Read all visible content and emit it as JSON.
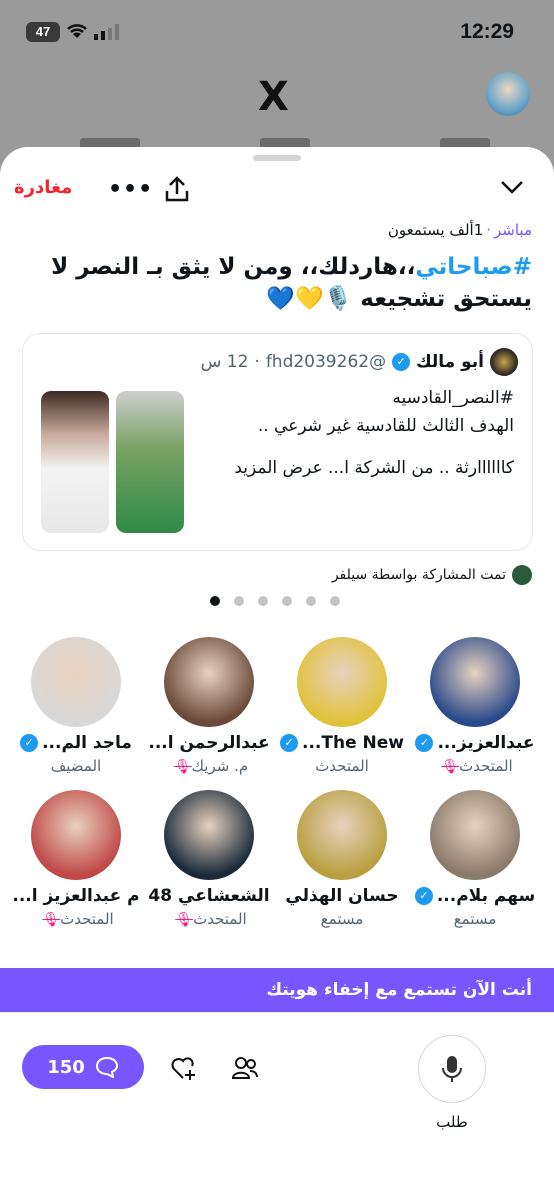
{
  "status": {
    "time": "12:29",
    "battery": "47"
  },
  "header": {
    "logo": "X"
  },
  "space": {
    "leave_label": "مغادرة",
    "live_label": "مباشر",
    "listeners": "1ألف يستمعون",
    "hashtag": "#صباحاتي",
    "title_rest": "،،هاردلك،، ومن لا يثق بـ النصر لا يستحق تشجيعه 🎙️💛💙"
  },
  "tweet": {
    "name": "أبو مالك",
    "handle": "@fhd2039262",
    "time": "12 س",
    "line1": "#النصر_القادسيه",
    "line2": "الهدف الثالث للقادسية غير شرعي ..",
    "line3": "كاااااارثة .. من الشركة ا... عرض المزيد"
  },
  "shared_by": "تمت المشاركة بواسطة سيلفر",
  "participants": [
    {
      "name": "عبدالعزيز...",
      "role": "المتحدث",
      "verified": true,
      "muted": true,
      "color": "#2b4a8b"
    },
    {
      "name": "The New...",
      "role": "المتحدث",
      "verified": true,
      "muted": false,
      "color": "#e0c23a"
    },
    {
      "name": "عبدالرحمن ا...",
      "role": "م. شريك",
      "verified": false,
      "muted": true,
      "color": "#6b4a3a"
    },
    {
      "name": "ماجد الم...",
      "role": "المضيف",
      "verified": true,
      "muted": false,
      "color": "#d8d8d8"
    },
    {
      "name": "سهم بلام...",
      "role": "مستمع",
      "verified": true,
      "muted": false,
      "color": "#8a7a6a"
    },
    {
      "name": "حسان الهذلي",
      "role": "مستمع",
      "verified": false,
      "muted": false,
      "color": "#b8a040"
    },
    {
      "name": "الشعشاعي 48",
      "role": "المتحدث",
      "verified": false,
      "muted": true,
      "color": "#1a2a3a"
    },
    {
      "name": "م عبدالعزيز ا...",
      "role": "المتحدث",
      "verified": false,
      "muted": true,
      "color": "#c04848"
    }
  ],
  "banner": "أنت الآن تستمع مع إخفاء هويتك",
  "bottom": {
    "comments": "150",
    "request_label": "طلب"
  }
}
